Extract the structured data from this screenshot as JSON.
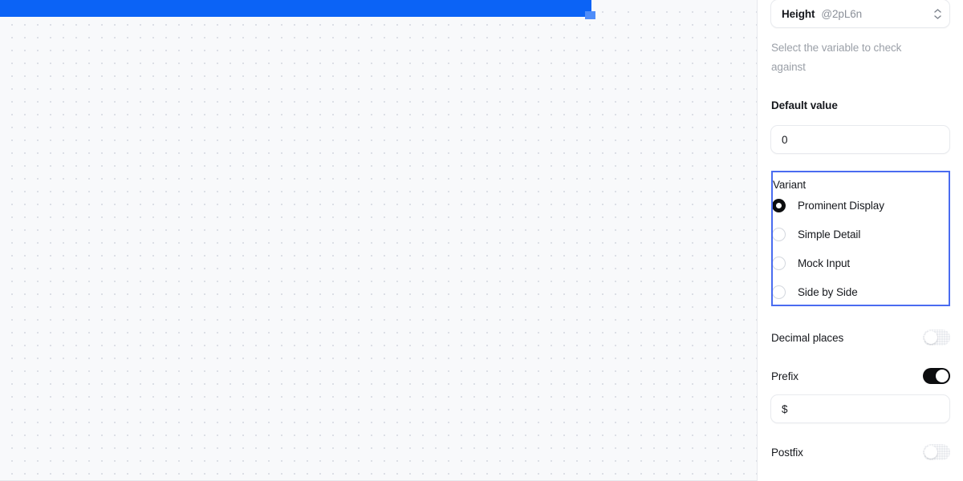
{
  "canvas": {
    "element_name": "selected-bar",
    "accent_color": "#0b63f6",
    "handle_color": "#4f8df9"
  },
  "panel": {
    "variable_select": {
      "name": "Height",
      "reference": "@2pL6n",
      "icon": "chevron-up-down-icon"
    },
    "helper_text": "Select the variable to check against",
    "default_value": {
      "label": "Default value",
      "value": "0"
    },
    "variant": {
      "title": "Variant",
      "focus_color": "#4a6cf0",
      "options": [
        {
          "label": "Prominent Display",
          "selected": true
        },
        {
          "label": "Simple Detail",
          "selected": false
        },
        {
          "label": "Mock Input",
          "selected": false
        },
        {
          "label": "Side by Side",
          "selected": false
        }
      ]
    },
    "decimal_places": {
      "label": "Decimal places",
      "enabled": false
    },
    "prefix": {
      "label": "Prefix",
      "enabled": true,
      "value": "$"
    },
    "postfix": {
      "label": "Postfix",
      "enabled": false
    }
  }
}
